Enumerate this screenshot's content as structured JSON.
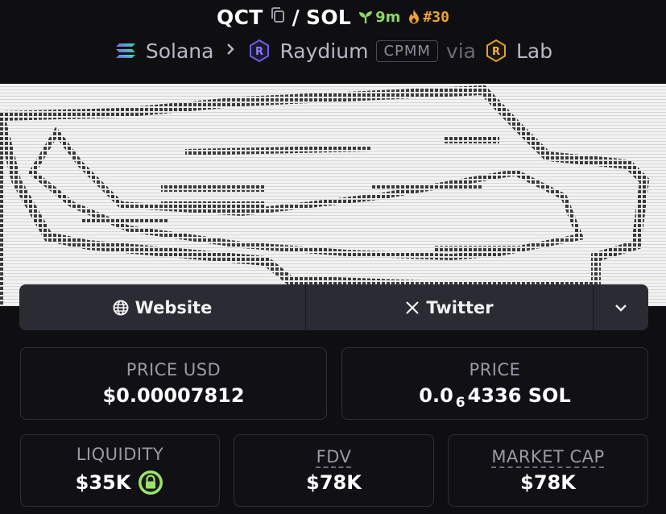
{
  "header": {
    "pair": "QCT",
    "slash": "/",
    "quote": "SOL",
    "age": "9m",
    "rank": "#30",
    "chain": "Solana",
    "dex": "Raydium",
    "pool_type": "CPMM",
    "via": "via",
    "launchpad": "Lab",
    "icons": [
      "copy-icon",
      "sprout-icon",
      "flame-icon",
      "solana-logo",
      "raydium-logo",
      "chevron-right-icon",
      "lab-logo"
    ]
  },
  "links": {
    "website": "Website",
    "twitter": "Twitter",
    "icons": [
      "globe-icon",
      "x-logo-icon",
      "chevron-down-icon"
    ]
  },
  "stats": {
    "price_usd_label": "PRICE USD",
    "price_usd_value": "$0.00007812",
    "price_label": "PRICE",
    "price_prefix": "0.0",
    "price_zeros": "6",
    "price_suffix": "4336 SOL",
    "liquidity_label": "LIQUIDITY",
    "liquidity_value": "$35K",
    "fdv_label": "FDV",
    "fdv_value": "$78K",
    "mcap_label": "MARKET CAP",
    "mcap_value": "$78K"
  },
  "colors": {
    "background": "#0f0f12",
    "age_green": "#8ed46a",
    "rank_orange": "#f0a030",
    "lock_green": "#9be36b"
  }
}
